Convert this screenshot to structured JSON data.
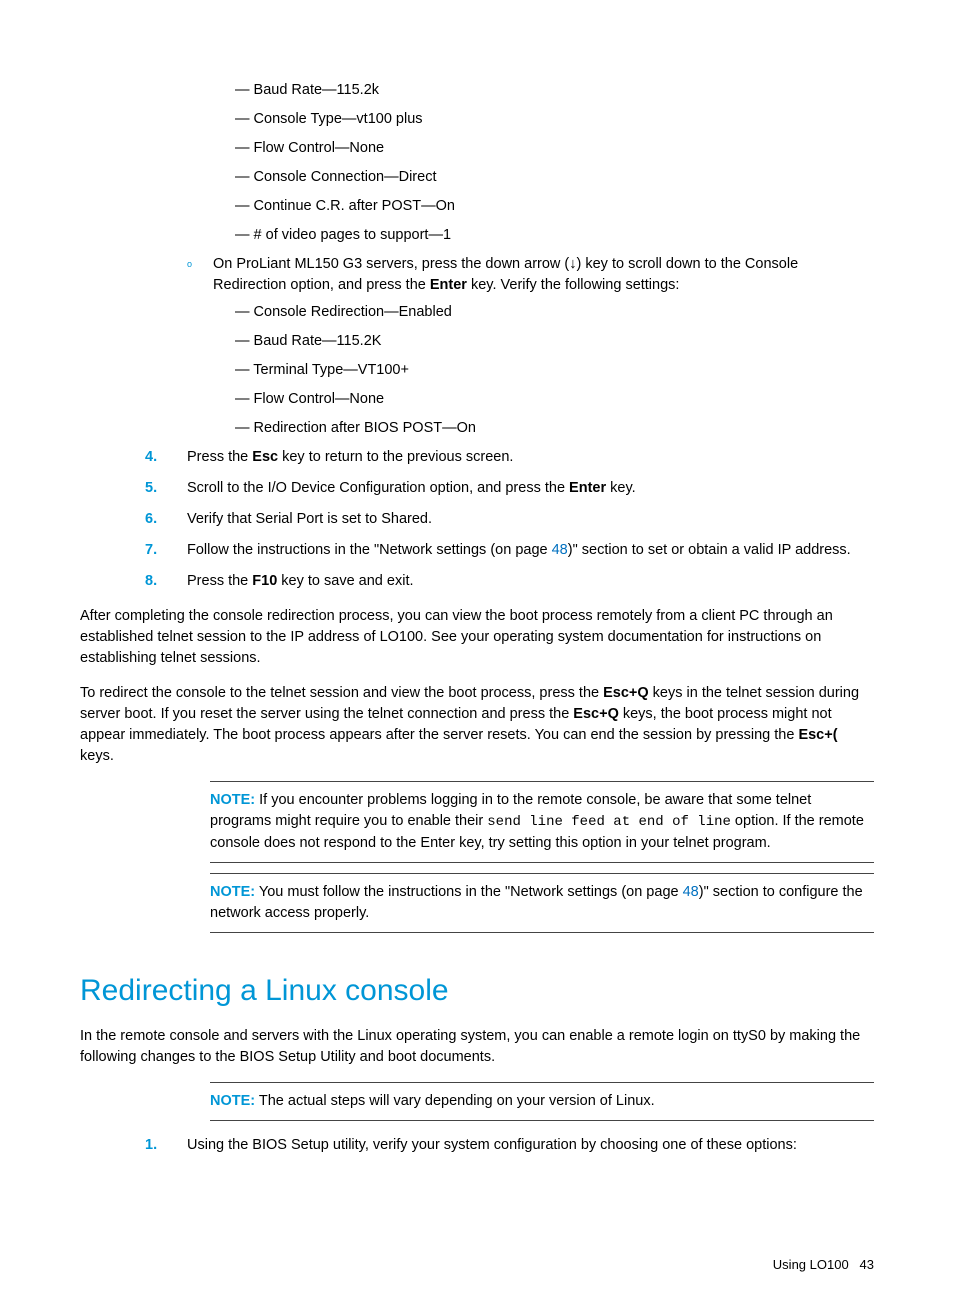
{
  "settings1": [
    "Baud Rate—115.2k",
    "Console Type—vt100 plus",
    "Flow Control—None",
    "Console Connection—Direct",
    "Continue C.R. after POST—On",
    "# of video pages to support—1"
  ],
  "ml150": {
    "pre": "On ProLiant ML150 G3 servers, press the down arrow (↓) key to scroll down to the Console Redirection option, and press the ",
    "enter": "Enter",
    "post": " key. Verify the following settings:"
  },
  "settings2": [
    "Console Redirection—Enabled",
    "Baud Rate—115.2K",
    "Terminal Type—VT100+",
    "Flow Control—None",
    "Redirection after BIOS POST—On"
  ],
  "steps": {
    "s4": {
      "a": "Press the ",
      "b": "Esc",
      "c": " key to return to the previous screen."
    },
    "s5": {
      "a": "Scroll to the I/O Device Configuration option, and press the ",
      "b": "Enter",
      "c": " key."
    },
    "s6": "Verify that Serial Port is set to Shared.",
    "s7": {
      "a": "Follow the instructions in the \"Network settings (on page ",
      "link": "48",
      "b": ")\" section to set or obtain a valid IP address."
    },
    "s8": {
      "a": "Press the ",
      "b": "F10",
      "c": " key to save and exit."
    }
  },
  "para1": "After completing the console redirection process, you can view the boot process remotely from a client PC through an established telnet session to the IP address of LO100. See your operating system documentation for instructions on establishing telnet sessions.",
  "para2": {
    "a": "To redirect the console to the telnet session and view the boot process, press the ",
    "b": "Esc+Q",
    "c": " keys in the telnet session during server boot. If you reset the server using the telnet connection and press the ",
    "d": "Esc+Q",
    "e": " keys, the boot process might not appear immediately. The boot process appears after the server resets. You can end the session by pressing the ",
    "f": "Esc+(",
    "g": " keys."
  },
  "note1": {
    "label": "NOTE:",
    "a": "  If you encounter problems logging in to the remote console, be aware that some telnet programs might require you to enable their ",
    "code": "send line feed at end of line",
    "b": " option. If the remote console does not respond to the Enter key, try setting this option in your telnet program."
  },
  "note2": {
    "label": "NOTE:",
    "a": "  You must follow the instructions in the \"Network settings (on page ",
    "link": "48",
    "b": ")\" section to configure the network access properly."
  },
  "heading": "Redirecting a Linux console",
  "para3": "In the remote console and servers with the Linux operating system, you can enable a remote login on ttyS0 by making the following changes to the BIOS Setup Utility and boot documents.",
  "note3": {
    "label": "NOTE:",
    "text": "  The actual steps will vary depending on your version of Linux."
  },
  "steps2": {
    "s1": "Using the BIOS Setup utility, verify your system configuration by choosing one of these options:"
  },
  "footer": {
    "label": "Using LO100",
    "page": "43"
  }
}
